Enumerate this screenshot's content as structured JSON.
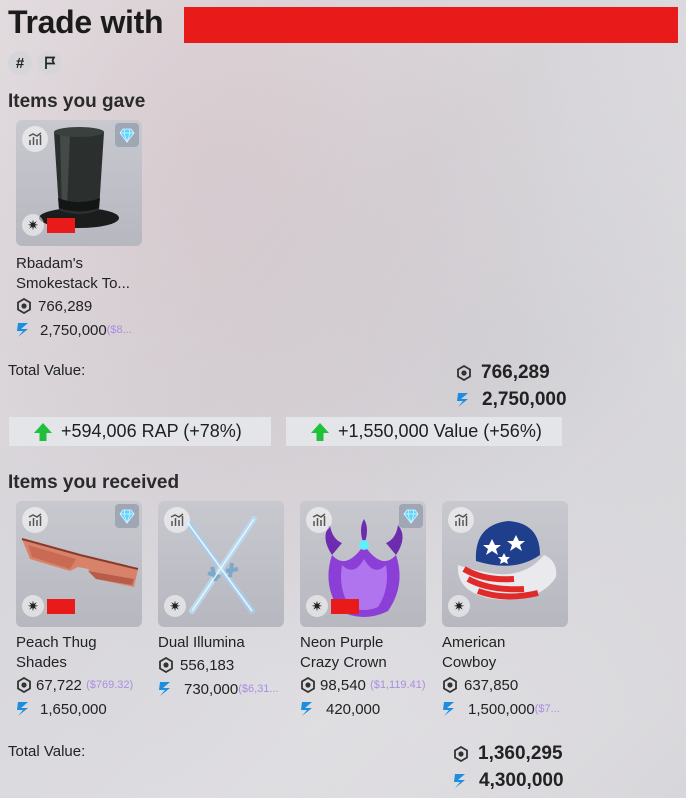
{
  "header": {
    "title": "Trade with"
  },
  "toolbar": {
    "hash_label": "#"
  },
  "gave": {
    "section_title": "Items you gave",
    "items": [
      {
        "name_line1": "Rbadam's",
        "name_line2": "Smokestack To...",
        "rap": "766,289",
        "value": "2,750,000",
        "usd": "($8..."
      }
    ],
    "total_label": "Total Value:",
    "total_rap": "766,289",
    "total_value": "2,750,000"
  },
  "gains": {
    "rap": "+594,006 RAP (+78%)",
    "value": "+1,550,000 Value (+56%)"
  },
  "received": {
    "section_title": "Items you received",
    "items": [
      {
        "name_line1": "Peach Thug",
        "name_line2": "Shades",
        "rap": "67,722",
        "rap_usd": "($769.32)",
        "value": "1,650,000",
        "value_usd": ""
      },
      {
        "name_line1": "Dual Illumina",
        "name_line2": "",
        "rap": "556,183",
        "rap_usd": "",
        "value": "730,000",
        "value_usd": "($6,31..."
      },
      {
        "name_line1": "Neon Purple",
        "name_line2": "Crazy Crown",
        "rap": "98,540",
        "rap_usd": "($1,119.41)",
        "value": "420,000",
        "value_usd": ""
      },
      {
        "name_line1": "American",
        "name_line2": "Cowboy",
        "rap": "637,850",
        "rap_usd": "",
        "value": "1,500,000",
        "value_usd": "($7..."
      }
    ],
    "total_label": "Total Value:",
    "total_rap": "1,360,295",
    "total_value": "4,300,000"
  },
  "colors": {
    "redaction": "#e81a1a",
    "gain_arrow": "#1fc03a",
    "value_icon": "#1d8de0",
    "usd_text": "#a98ee0"
  }
}
